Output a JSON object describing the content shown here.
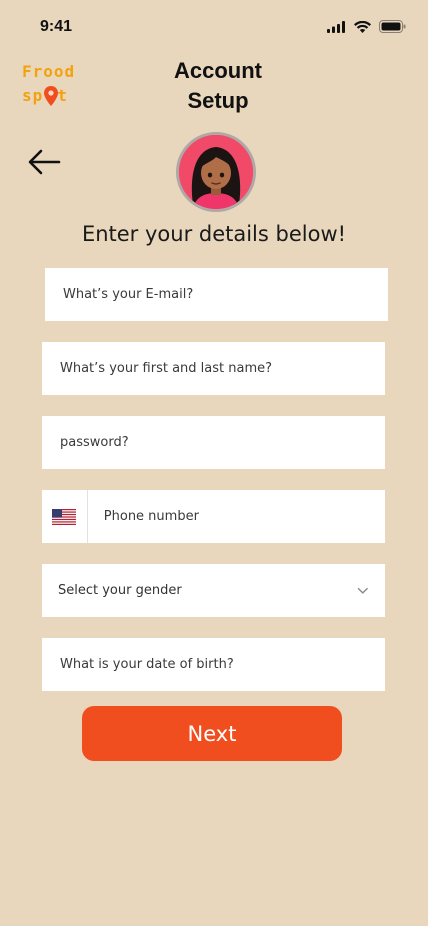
{
  "status_bar": {
    "time": "9:41"
  },
  "logo": {
    "line1": "Frood",
    "line2_prefix": "sp",
    "line2_suffix": "t",
    "brand_color": "#F2A20E",
    "pin_color": "#F04E1E"
  },
  "header": {
    "title_line1": "Account",
    "title_line2": "Setup",
    "back_icon": "arrow-left-icon"
  },
  "subtitle": "Enter your details below!",
  "form": {
    "email_placeholder": "What’s your E-mail?",
    "name_placeholder": "What’s your first and last name?",
    "password_placeholder": "password?",
    "phone_placeholder": "Phone number",
    "phone_country_icon": "us-flag-icon",
    "gender_label": "Select your gender",
    "gender_icon": "chevron-down-icon",
    "dob_placeholder": "What is your date of birth?"
  },
  "next_label": "Next",
  "colors": {
    "background": "#E8D7BC",
    "accent": "#F04E1E",
    "field": "#FFFFFF"
  }
}
